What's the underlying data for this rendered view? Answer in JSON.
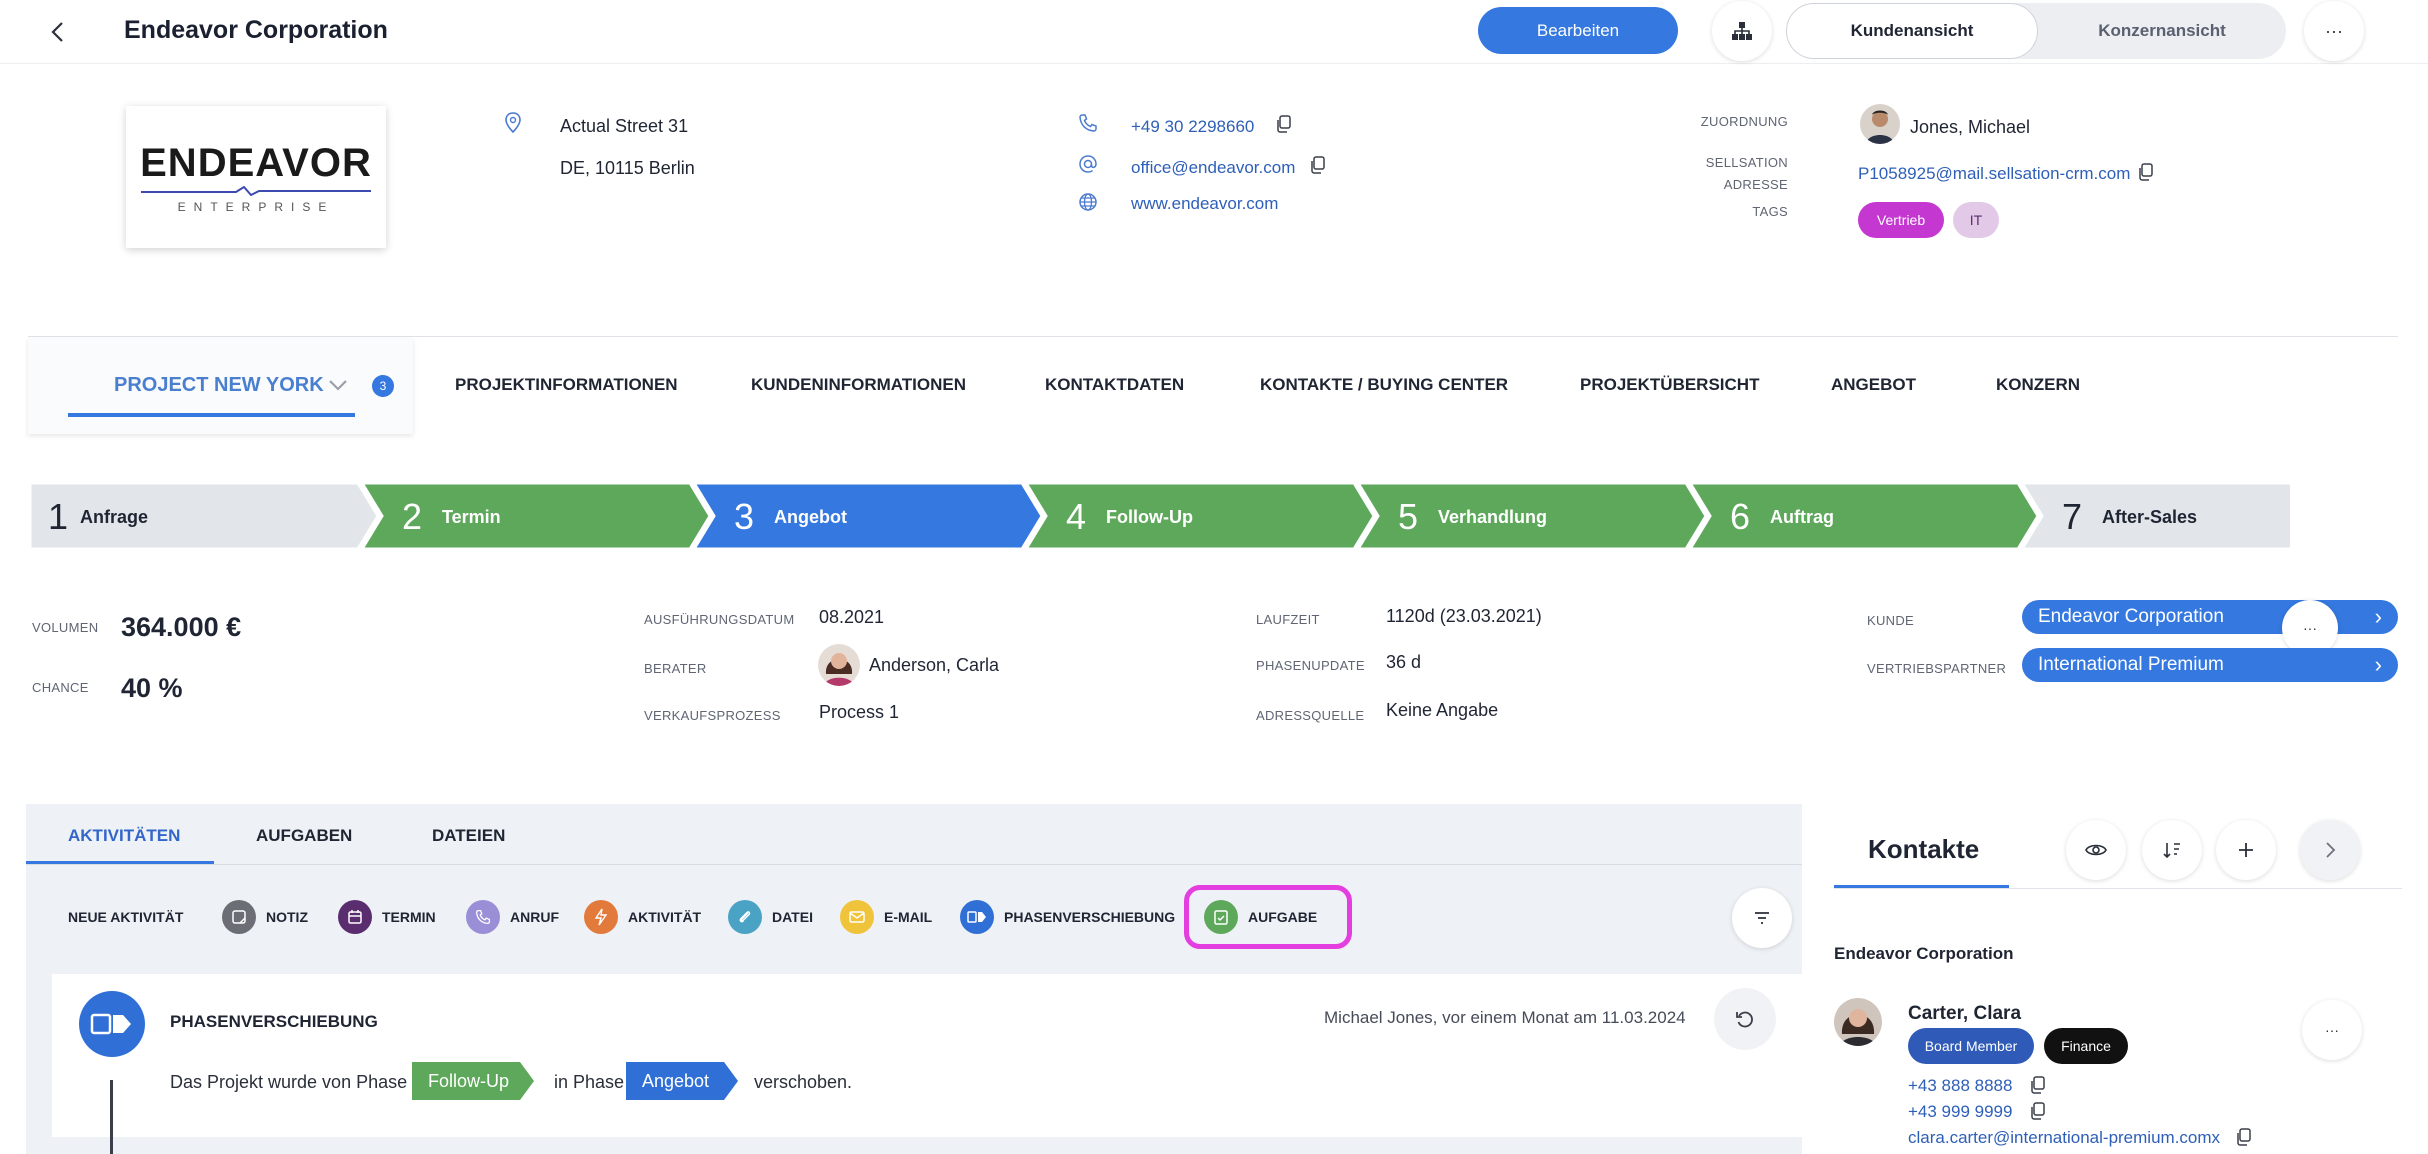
{
  "header": {
    "title": "Endeavor Corporation",
    "edit_label": "Bearbeiten",
    "view_customer": "Kundenansicht",
    "view_group": "Konzernansicht",
    "more": "···"
  },
  "company": {
    "logo_text": "ENDEAVOR",
    "logo_sub": "ENTERPRISE",
    "street": "Actual Street 31",
    "city": "DE, 10115 Berlin",
    "phone": "+49 30 2298660",
    "email": "office@endeavor.com",
    "website": "www.endeavor.com",
    "assignment_label": "ZUORDNUNG",
    "assignment_value": "Jones, Michael",
    "sellsation_label_1": "SELLSATION",
    "sellsation_label_2": "ADRESSE",
    "sellsation_value": "P1058925@mail.sellsation-crm.com",
    "tags_label": "TAGS",
    "tags": [
      "Vertrieb",
      "IT"
    ]
  },
  "project": {
    "name": "PROJECT NEW YORK",
    "count": "3"
  },
  "nav_tabs": [
    "PROJEKTINFORMATIONEN",
    "KUNDENINFORMATIONEN",
    "KONTAKTDATEN",
    "KONTAKTE / BUYING CENTER",
    "PROJEKTÜBERSICHT",
    "ANGEBOT",
    "KONZERN"
  ],
  "phases": [
    {
      "num": "1",
      "label": "Anfrage",
      "state": "inactive"
    },
    {
      "num": "2",
      "label": "Termin",
      "state": "done"
    },
    {
      "num": "3",
      "label": "Angebot",
      "state": "current"
    },
    {
      "num": "4",
      "label": "Follow-Up",
      "state": "done"
    },
    {
      "num": "5",
      "label": "Verhandlung",
      "state": "done"
    },
    {
      "num": "6",
      "label": "Auftrag",
      "state": "done"
    },
    {
      "num": "7",
      "label": "After-Sales",
      "state": "inactive"
    }
  ],
  "details": {
    "volume_label": "VOLUMEN",
    "volume_value": "364.000 €",
    "chance_label": "CHANCE",
    "chance_value": "40 %",
    "exec_date_label": "AUSFÜHRUNGSDATUM",
    "exec_date_value": "08.2021",
    "advisor_label": "BERATER",
    "advisor_value": "Anderson, Carla",
    "process_label": "VERKAUFSPROZESS",
    "process_value": "Process 1",
    "runtime_label": "LAUFZEIT",
    "runtime_value": "1120d (23.03.2021)",
    "phase_update_label": "PHASENUPDATE",
    "phase_update_value": "36 d",
    "source_label": "ADRESSQUELLE",
    "source_value": "Keine Angabe",
    "customer_label": "KUNDE",
    "customer_value": "Endeavor Corporation",
    "partner_label": "VERTRIEBSPARTNER",
    "partner_value": "International Premium"
  },
  "activity": {
    "tabs": [
      "AKTIVITÄTEN",
      "AUFGABEN",
      "DATEIEN"
    ],
    "new_label": "NEUE AKTIVITÄT",
    "quick": [
      {
        "label": "NOTIZ",
        "color": "#6b6e75",
        "icon": "note-icon"
      },
      {
        "label": "TERMIN",
        "color": "#5a2d6e",
        "icon": "calendar-icon"
      },
      {
        "label": "ANRUF",
        "color": "#9a8fd6",
        "icon": "phone-icon"
      },
      {
        "label": "AKTIVITÄT",
        "color": "#e27a3b",
        "icon": "bolt-icon"
      },
      {
        "label": "DATEI",
        "color": "#4aa3c4",
        "icon": "paperclip-icon"
      },
      {
        "label": "E-MAIL",
        "color": "#efc33a",
        "icon": "mail-icon"
      },
      {
        "label": "PHASENVERSCHIEBUNG",
        "color": "#2f6fd6",
        "icon": "phase-shift-icon"
      },
      {
        "label": "AUFGABE",
        "color": "#5ea85c",
        "icon": "task-icon"
      }
    ],
    "feed": {
      "title": "PHASENVERSCHIEBUNG",
      "meta": "Michael Jones, vor einem Monat am 11.03.2024",
      "text_1": "Das Projekt wurde von Phase",
      "from": "Follow-Up",
      "text_2": "in Phase",
      "to": "Angebot",
      "text_3": "verschoben."
    }
  },
  "contacts": {
    "title": "Kontakte",
    "company": "Endeavor Corporation",
    "person": {
      "name": "Carter, Clara",
      "roles": [
        "Board Member",
        "Finance"
      ],
      "phone_1": "+43 888 8888",
      "phone_2": "+43 999 9999",
      "email": "clara.carter@international-premium.comx"
    }
  },
  "colors": {
    "primary": "#3478e0",
    "done": "#5ea85c",
    "inactive": "#e2e5ea",
    "highlight": "#e43de0"
  }
}
